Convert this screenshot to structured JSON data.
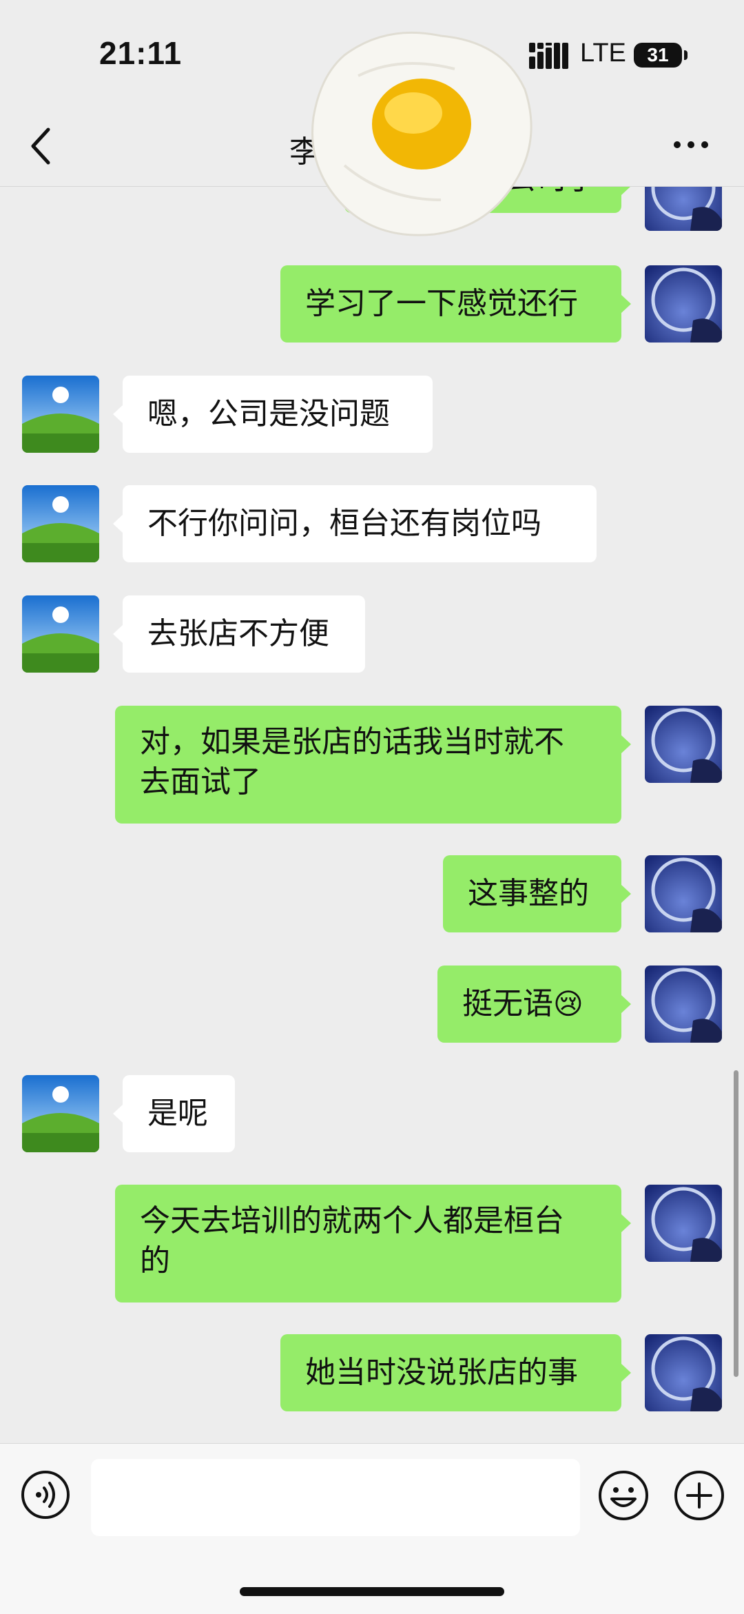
{
  "status_bar": {
    "time": "21:11",
    "network": "LTE",
    "battery": "31"
  },
  "header": {
    "title": "李"
  },
  "messages": [
    {
      "side": "me",
      "text": "公司了"
    },
    {
      "side": "me",
      "text": "学习了一下感觉还行"
    },
    {
      "side": "them",
      "text": "嗯，公司是没问题"
    },
    {
      "side": "them",
      "text": "不行你问问，桓台还有岗位吗"
    },
    {
      "side": "them",
      "text": "去张店不方便"
    },
    {
      "side": "me",
      "text_line1": "对，如果是张店的话我当时就不",
      "text_line2": "去面试了"
    },
    {
      "side": "me",
      "text": "这事整的"
    },
    {
      "side": "me",
      "text": "挺无语",
      "emoji": "😢"
    },
    {
      "side": "them",
      "text": "是呢"
    },
    {
      "side": "me",
      "text_line1": "今天去培训的就两个人都是桓台",
      "text_line2": "的"
    },
    {
      "side": "me",
      "text": "她当时没说张店的事"
    }
  ],
  "colors": {
    "my_bubble": "#95ec69",
    "their_bubble": "#ffffff",
    "background": "#ededed"
  },
  "icons": {
    "back": "chevron-left-icon",
    "more": "ellipsis-icon",
    "voice": "voice-icon",
    "emoji": "smiley-icon",
    "plus": "plus-circle-icon",
    "sticker": "fried-egg-sticker"
  }
}
